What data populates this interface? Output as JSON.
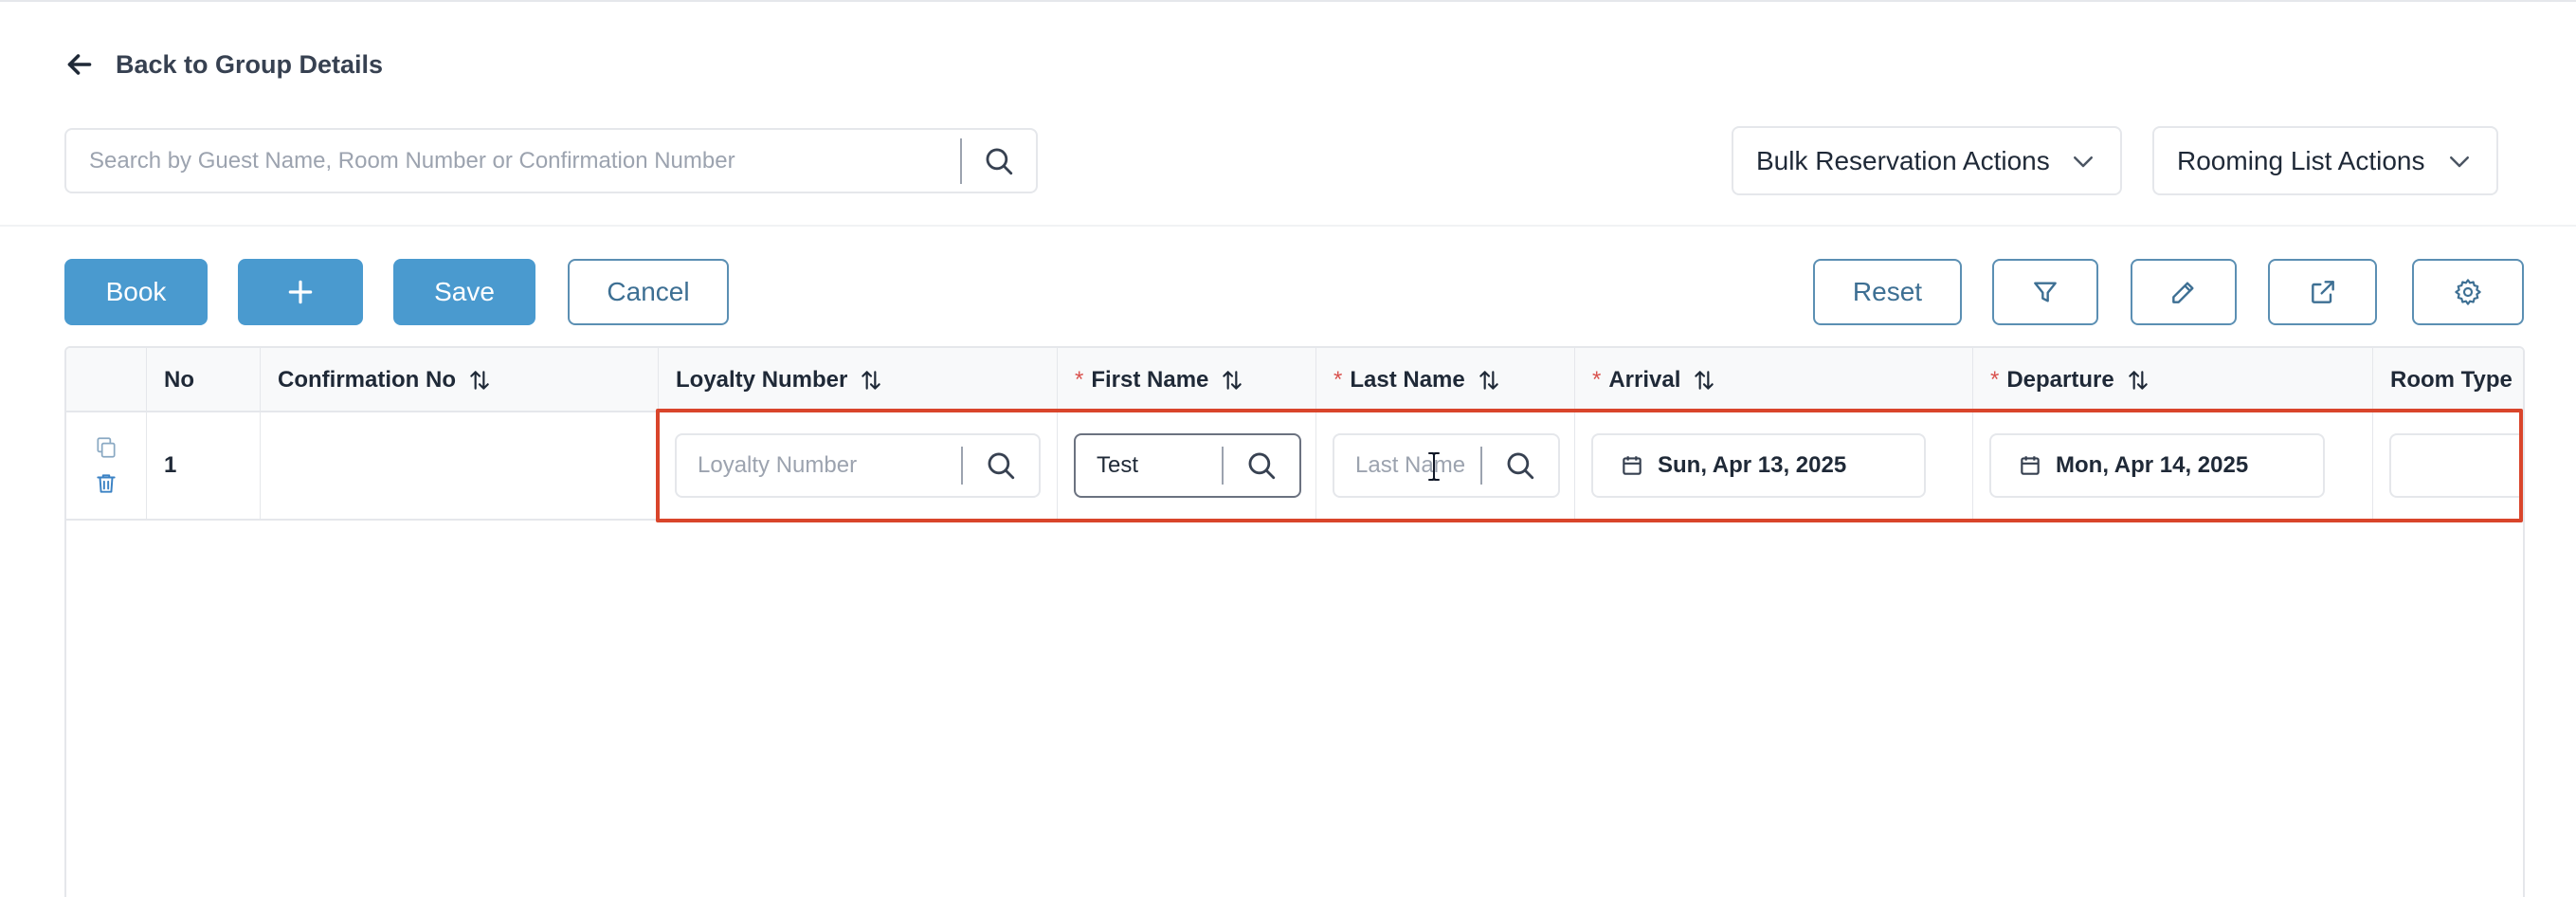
{
  "nav": {
    "back_label": "Back to Group Details"
  },
  "search": {
    "placeholder": "Search by Guest Name, Room Number or Confirmation Number",
    "value": ""
  },
  "dropdowns": {
    "bulk_label": "Bulk Reservation Actions",
    "rooming_label": "Rooming List Actions"
  },
  "toolbar": {
    "book_label": "Book",
    "save_label": "Save",
    "cancel_label": "Cancel",
    "reset_label": "Reset"
  },
  "table": {
    "headers": {
      "no": "No",
      "confirmation": "Confirmation No",
      "loyalty": "Loyalty Number",
      "first_name": "First Name",
      "last_name": "Last Name",
      "arrival": "Arrival",
      "departure": "Departure",
      "room_type": "Room Type"
    },
    "required_mark": "*",
    "rows": [
      {
        "no": "1",
        "confirmation": "",
        "loyalty_placeholder": "Loyalty Number",
        "loyalty_value": "",
        "first_name": "Test",
        "last_name_placeholder": "Last Name",
        "last_name_value": "",
        "arrival": "Sun, Apr 13, 2025",
        "departure": "Mon, Apr 14, 2025",
        "room_type": ""
      }
    ]
  },
  "colors": {
    "primary": "#4a9acf",
    "outline_text": "#3d6f93",
    "highlight": "#d9452b",
    "required": "#d9534f"
  },
  "icons": [
    "arrow-left-icon",
    "search-icon",
    "chevron-down-icon",
    "plus-icon",
    "filter-icon",
    "pencil-icon",
    "external-link-icon",
    "gear-icon",
    "sort-icon",
    "copy-icon",
    "trash-icon",
    "calendar-icon"
  ]
}
